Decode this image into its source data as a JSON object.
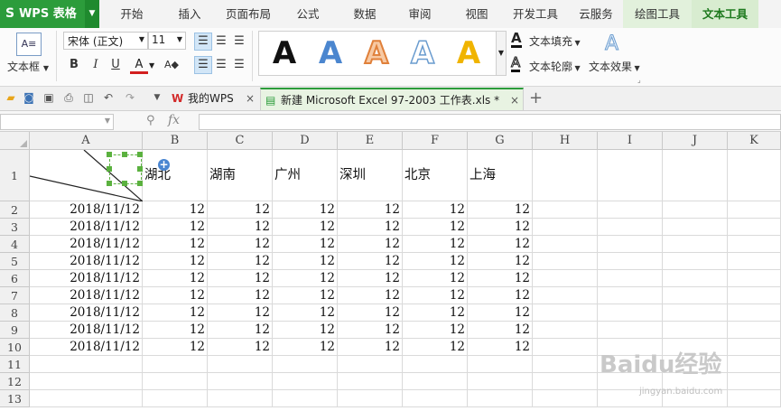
{
  "app": {
    "name": "WPS 表格"
  },
  "menu_tabs": [
    "开始",
    "插入",
    "页面布局",
    "公式",
    "数据",
    "审阅",
    "视图",
    "开发工具",
    "云服务",
    "绘图工具",
    "文本工具"
  ],
  "ribbon": {
    "textbox_label": "文本框",
    "font_name": "宋体 (正文)",
    "font_size": "11",
    "style_letter": "A",
    "text_fill": "文本填充",
    "text_outline": "文本轮廓",
    "text_effect": "文本效果"
  },
  "doc_tabs": {
    "home": "我的WPS",
    "file": "新建 Microsoft Excel 97-2003 工作表.xls *"
  },
  "formula_bar": {
    "fx": "fx"
  },
  "sheet": {
    "columns": [
      "A",
      "B",
      "C",
      "D",
      "E",
      "F",
      "G",
      "H",
      "I",
      "J",
      "K"
    ],
    "rows": [
      "1",
      "2",
      "3",
      "4",
      "5",
      "6",
      "7",
      "8",
      "9",
      "10",
      "11",
      "12",
      "13"
    ],
    "header_row": [
      "湖北",
      "湖南",
      "广州",
      "深圳",
      "北京",
      "上海"
    ],
    "date_value": "2018/11/12",
    "number_value": "12",
    "data_row_count": 9
  },
  "watermark": {
    "brand": "Baidu经验",
    "url": "jingyan.baidu.com"
  },
  "colors": {
    "wps_green": "#2c9c3b",
    "active_tab": "#d8ecd0",
    "handle_green": "#5bb13f"
  }
}
